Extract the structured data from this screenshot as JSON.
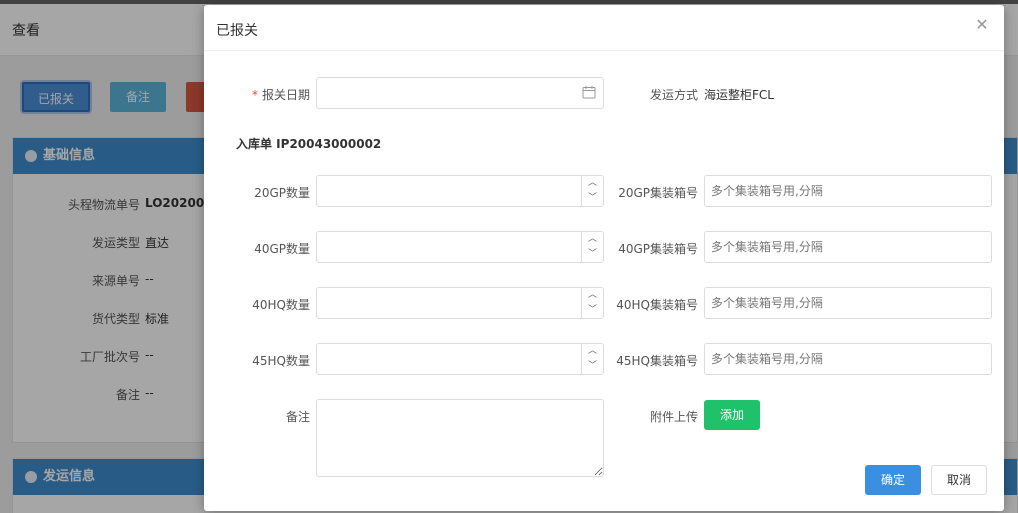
{
  "background": {
    "page_title": "查看",
    "toolbar": {
      "declared_label": "已报关",
      "remark_label": "备注",
      "red_label": ""
    },
    "basic_panel": {
      "title": "基础信息",
      "rows": [
        {
          "key": "头程物流单号",
          "value": "LO20200050"
        },
        {
          "key": "发运类型",
          "value": "直达"
        },
        {
          "key": "来源单号",
          "value": "--"
        },
        {
          "key": "货代类型",
          "value": "标准"
        },
        {
          "key": "工厂批次号",
          "value": "--"
        },
        {
          "key": "备注",
          "value": "--"
        }
      ]
    },
    "ship_panel": {
      "title": "发运信息"
    }
  },
  "dialog": {
    "title": "已报关",
    "close_icon": "close-icon",
    "declare_date": {
      "label": "报关日期",
      "required_mark": "*",
      "value": "",
      "icon": "calendar-icon"
    },
    "ship_method": {
      "label": "发运方式",
      "value": "海运整柜FCL"
    },
    "inbound": {
      "text": "入库单 IP20043000002"
    },
    "rows": [
      {
        "qty_label": "20GP数量",
        "qty_value": "",
        "container_label": "20GP集装箱号",
        "container_placeholder": "多个集装箱号用,分隔"
      },
      {
        "qty_label": "40GP数量",
        "qty_value": "",
        "container_label": "40GP集装箱号",
        "container_placeholder": "多个集装箱号用,分隔"
      },
      {
        "qty_label": "40HQ数量",
        "qty_value": "",
        "container_label": "40HQ集装箱号",
        "container_placeholder": "多个集装箱号用,分隔"
      },
      {
        "qty_label": "45HQ数量",
        "qty_value": "",
        "container_label": "45HQ集装箱号",
        "container_placeholder": "多个集装箱号用,分隔"
      }
    ],
    "remark": {
      "label": "备注",
      "value": ""
    },
    "attachment": {
      "label": "附件上传",
      "button": "添加"
    },
    "footer": {
      "ok": "确定",
      "cancel": "取消"
    }
  },
  "colors": {
    "primary": "#3b8fe0",
    "success": "#1fc16b",
    "panel_header": "#3e8ed0",
    "required": "#e74c3c"
  }
}
